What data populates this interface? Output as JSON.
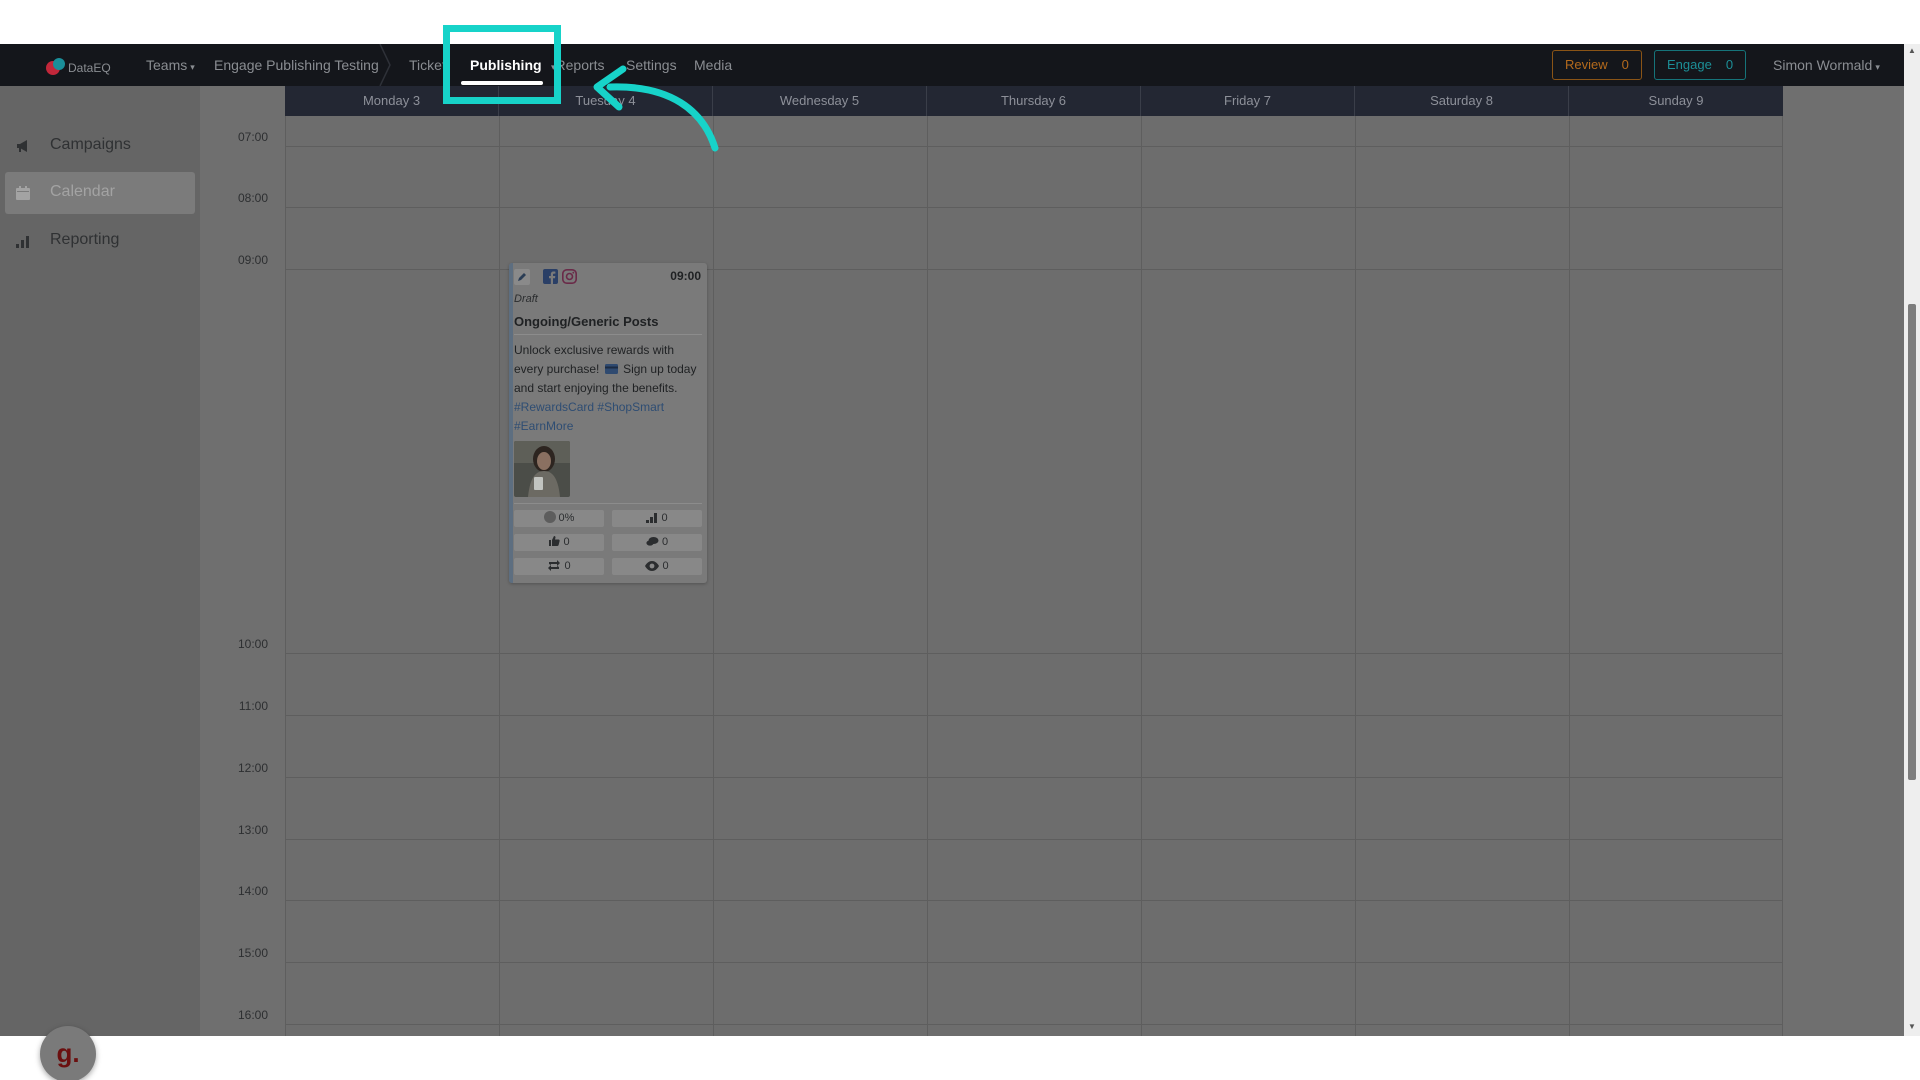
{
  "nav": {
    "logo_text": "DataEQ",
    "teams": "Teams",
    "breadcrumb_team": "Engage Publishing Testing",
    "tickets": "Tickets",
    "publishing": "Publishing",
    "reports": "Reports",
    "settings": "Settings",
    "media": "Media",
    "review_label": "Review",
    "review_count": "0",
    "engage_label": "Engage",
    "engage_count": "0",
    "user_name": "Simon Wormald"
  },
  "sidebar": {
    "items": [
      {
        "label": "Campaigns",
        "icon": "megaphone-icon",
        "active": false
      },
      {
        "label": "Calendar",
        "icon": "calendar-icon",
        "active": true
      },
      {
        "label": "Reporting",
        "icon": "bar-chart-icon",
        "active": false
      }
    ],
    "badge": "g."
  },
  "calendar": {
    "days": [
      "Monday 3",
      "Tuesday 4",
      "Wednesday 5",
      "Thursday 6",
      "Friday 7",
      "Saturday 8",
      "Sunday 9"
    ],
    "times": [
      "07:00",
      "08:00",
      "09:00",
      "10:00",
      "11:00",
      "12:00",
      "13:00",
      "14:00",
      "15:00",
      "16:00"
    ]
  },
  "post": {
    "day": "Tuesday 4",
    "time": "09:00",
    "status": "Draft",
    "campaign": "Ongoing/Generic Posts",
    "text_1": "Unlock exclusive rewards with every purchase!",
    "text_2": "Sign up today and start enjoying the benefits.",
    "hashtags": [
      "#RewardsCard",
      "#ShopSmart",
      "#EarnMore"
    ],
    "channels": [
      "facebook-icon",
      "instagram-icon"
    ],
    "stats": {
      "sentiment": "0%",
      "reach": "0",
      "likes": "0",
      "comments": "0",
      "shares": "0",
      "views": "0"
    }
  },
  "colors": {
    "highlight": "#17d3c9",
    "review": "#b46a1c",
    "engage": "#1c8f97"
  }
}
